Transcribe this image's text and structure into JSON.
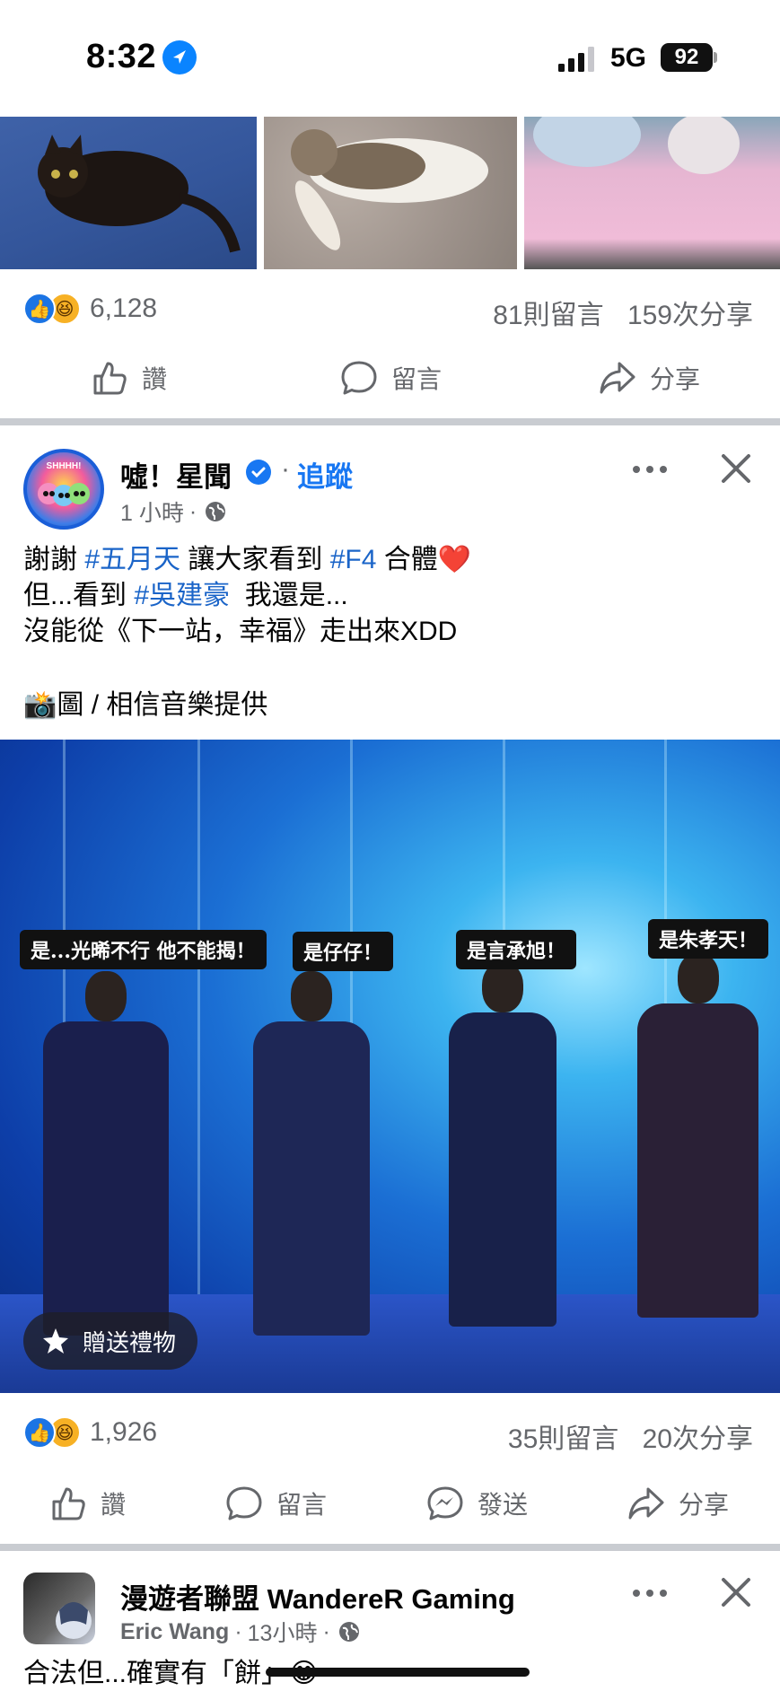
{
  "status_bar": {
    "time": "8:32",
    "network": "5G",
    "battery": "92"
  },
  "prev_post": {
    "reaction_count": "6,128",
    "comments": "81則留言",
    "shares": "159次分享",
    "actions": {
      "like": "讚",
      "comment": "留言",
      "share": "分享"
    }
  },
  "post": {
    "page_name": "噓！星聞",
    "follow": "追蹤",
    "time": "1 小時",
    "avatar_text": "SHHHH!",
    "text_lines": [
      {
        "parts": [
          {
            "t": "謝謝 "
          },
          {
            "t": "#五月天",
            "tag": true
          },
          {
            "t": " 讓大家看到 "
          },
          {
            "t": "#F4",
            "tag": true
          },
          {
            "t": " 合體"
          }
        ]
      },
      {
        "parts": [
          {
            "t": "但...看到 "
          },
          {
            "t": "#吳建豪",
            "tag": true
          },
          {
            "t": "  我還是..."
          }
        ]
      },
      {
        "parts": [
          {
            "t": "沒能從《下一站，幸福》走出來XDD"
          }
        ]
      }
    ],
    "credit": "圖 / 相信音樂提供",
    "image_captions": [
      "是...光晞不行 他不能揭！",
      "是仔仔！",
      "是言承旭！",
      "是朱孝天！"
    ],
    "gift_label": "贈送禮物",
    "reaction_count": "1,926",
    "comments": "35則留言",
    "shares": "20次分享",
    "actions": {
      "like": "讚",
      "comment": "留言",
      "send": "發送",
      "share": "分享"
    }
  },
  "next_post": {
    "page_name": "漫遊者聯盟 WandereR Gaming",
    "author": "Eric Wang",
    "time": "13小時",
    "text": "合法但...確實有「餅」"
  },
  "colors": {
    "accent": "#1877f2",
    "secondary_text": "#65676b",
    "divider": "#c9ccd1"
  },
  "icons": [
    "location-arrow-icon",
    "signal-icon",
    "like-icon",
    "comment-icon",
    "share-icon",
    "messenger-icon",
    "more-icon",
    "close-icon",
    "globe-icon",
    "verified-icon",
    "gift-icon",
    "camera-icon"
  ]
}
